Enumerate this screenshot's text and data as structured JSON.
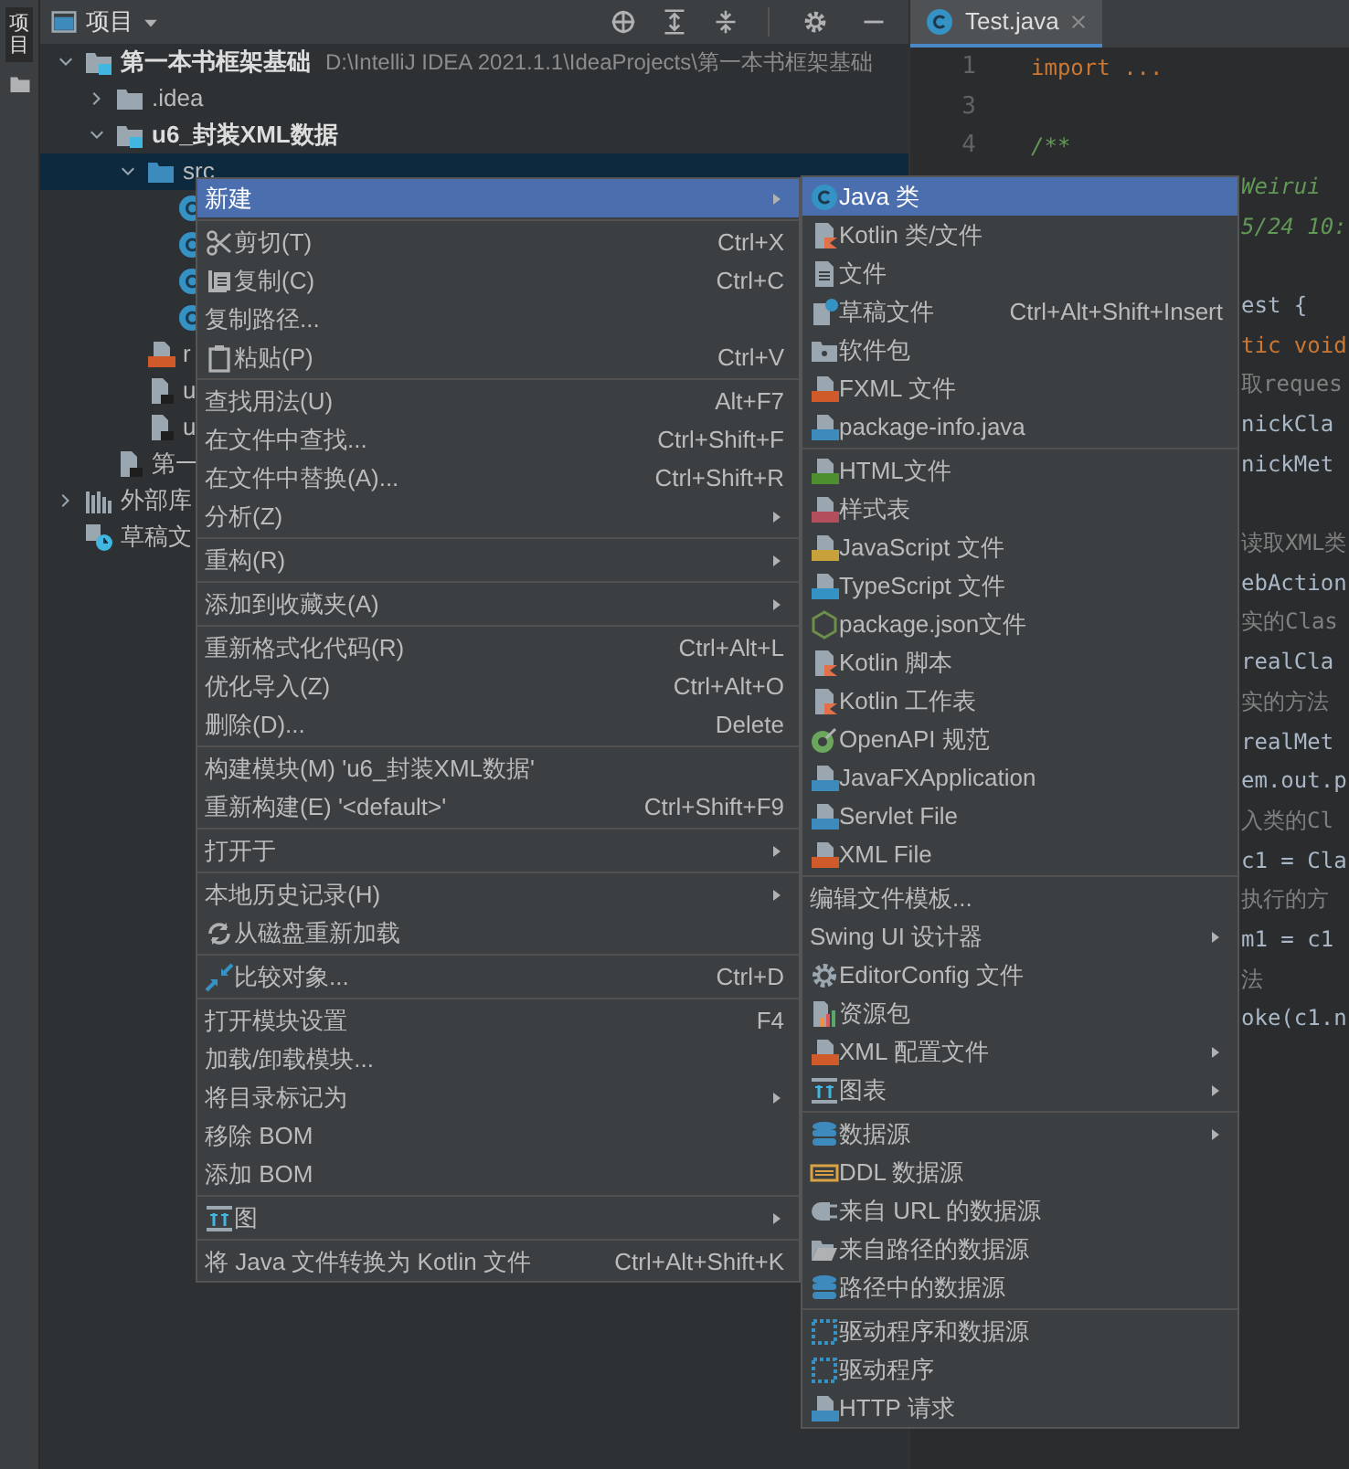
{
  "tool_strip": {
    "label": "项目"
  },
  "project_panel": {
    "title": "项目",
    "tree": [
      {
        "kind": "module",
        "label": "第一本书框架基础",
        "path": "D:\\IntelliJ IDEA 2021.1.1\\IdeaProjects\\第一本书框架基础",
        "expanded": true,
        "selected": false,
        "children": [
          {
            "kind": "folder",
            "label": ".idea",
            "expanded": false,
            "selected": false
          },
          {
            "kind": "module",
            "label": "u6_封装XML数据",
            "expanded": true,
            "selected": false,
            "children": [
              {
                "kind": "source",
                "label": "src",
                "expanded": true,
                "selected": true,
                "children": [
                  {
                    "kind": "class",
                    "selected": false
                  },
                  {
                    "kind": "class",
                    "selected": false
                  },
                  {
                    "kind": "class",
                    "selected": false
                  },
                  {
                    "kind": "class",
                    "selected": false
                  }
                ]
              },
              {
                "kind": "xml",
                "label": "r",
                "selected": false
              },
              {
                "kind": "file",
                "label": "u",
                "selected": false
              },
              {
                "kind": "file",
                "label": "u",
                "selected": false
              }
            ]
          },
          {
            "kind": "file",
            "label": "第一",
            "selected": false
          }
        ]
      },
      {
        "kind": "library",
        "label": "外部库",
        "expanded": false,
        "selected": false
      },
      {
        "kind": "scratch",
        "label": "草稿文",
        "selected": false
      }
    ]
  },
  "editor": {
    "tab": {
      "label": "Test.java",
      "selected": true
    },
    "lines": [
      {
        "number": "1",
        "text": "import ...",
        "kind": "keyword"
      },
      {
        "number": "3"
      },
      {
        "number": "4",
        "text": "/**",
        "kind": "comment"
      },
      {
        "text": "Weirui",
        "kind": "comment"
      },
      {
        "text": "5/24 10:",
        "kind": "comment"
      },
      {
        "kind": "blank"
      },
      {
        "text": "est {",
        "kind": "code"
      },
      {
        "text": "tic void",
        "kind": "keyword"
      },
      {
        "text": "取reques",
        "kind": "note"
      },
      {
        "text": "nickCla",
        "kind": "code"
      },
      {
        "text": "nickMet",
        "kind": "code"
      },
      {
        "kind": "blank"
      },
      {
        "text": "读取XML类",
        "kind": "note"
      },
      {
        "text": "ebAction",
        "kind": "code"
      },
      {
        "text": "实的Clas",
        "kind": "note"
      },
      {
        "text": "realCla",
        "kind": "code"
      },
      {
        "text": "实的方法",
        "kind": "note"
      },
      {
        "text": "realMet",
        "kind": "code"
      },
      {
        "text": "em.out.p",
        "kind": "code"
      },
      {
        "text": "入类的Cl",
        "kind": "note"
      },
      {
        "text": "c1 = Cla",
        "kind": "code"
      },
      {
        "text": "执行的方",
        "kind": "note"
      },
      {
        "text": "m1 = c1",
        "kind": "code"
      },
      {
        "text": "法",
        "kind": "note"
      },
      {
        "text": "oke(c1.n",
        "kind": "code"
      }
    ]
  },
  "context_menu": [
    {
      "kind": "item",
      "label": "新建",
      "submenu": true,
      "selected": true
    },
    {
      "kind": "separator"
    },
    {
      "kind": "item",
      "label": "剪切(T)",
      "shortcut": "Ctrl+X",
      "submenu": false,
      "selected": false
    },
    {
      "kind": "item",
      "label": "复制(C)",
      "shortcut": "Ctrl+C",
      "submenu": false,
      "selected": false
    },
    {
      "kind": "item",
      "label": "复制路径...",
      "submenu": false,
      "selected": false
    },
    {
      "kind": "item",
      "label": "粘贴(P)",
      "shortcut": "Ctrl+V",
      "submenu": false,
      "selected": false
    },
    {
      "kind": "separator"
    },
    {
      "kind": "item",
      "label": "查找用法(U)",
      "shortcut": "Alt+F7",
      "submenu": false,
      "selected": false
    },
    {
      "kind": "item",
      "label": "在文件中查找...",
      "shortcut": "Ctrl+Shift+F",
      "submenu": false,
      "selected": false
    },
    {
      "kind": "item",
      "label": "在文件中替换(A)...",
      "shortcut": "Ctrl+Shift+R",
      "submenu": false,
      "selected": false
    },
    {
      "kind": "item",
      "label": "分析(Z)",
      "submenu": true,
      "selected": false
    },
    {
      "kind": "separator"
    },
    {
      "kind": "item",
      "label": "重构(R)",
      "submenu": true,
      "selected": false
    },
    {
      "kind": "separator"
    },
    {
      "kind": "item",
      "label": "添加到收藏夹(A)",
      "submenu": true,
      "selected": false
    },
    {
      "kind": "separator"
    },
    {
      "kind": "item",
      "label": "重新格式化代码(R)",
      "shortcut": "Ctrl+Alt+L",
      "submenu": false,
      "selected": false
    },
    {
      "kind": "item",
      "label": "优化导入(Z)",
      "shortcut": "Ctrl+Alt+O",
      "submenu": false,
      "selected": false
    },
    {
      "kind": "item",
      "label": "删除(D)...",
      "shortcut": "Delete",
      "submenu": false,
      "selected": false
    },
    {
      "kind": "separator"
    },
    {
      "kind": "item",
      "label": "构建模块(M) 'u6_封装XML数据'",
      "submenu": false,
      "selected": false
    },
    {
      "kind": "item",
      "label": "重新构建(E) '<default>'",
      "shortcut": "Ctrl+Shift+F9",
      "submenu": false,
      "selected": false
    },
    {
      "kind": "separator"
    },
    {
      "kind": "item",
      "label": "打开于",
      "submenu": true,
      "selected": false
    },
    {
      "kind": "separator"
    },
    {
      "kind": "item",
      "label": "本地历史记录(H)",
      "submenu": true,
      "selected": false
    },
    {
      "kind": "item",
      "label": "从磁盘重新加载",
      "submenu": false,
      "selected": false
    },
    {
      "kind": "separator"
    },
    {
      "kind": "item",
      "label": "比较对象...",
      "shortcut": "Ctrl+D",
      "submenu": false,
      "selected": false
    },
    {
      "kind": "separator"
    },
    {
      "kind": "item",
      "label": "打开模块设置",
      "shortcut": "F4",
      "submenu": false,
      "selected": false
    },
    {
      "kind": "item",
      "label": "加载/卸载模块...",
      "submenu": false,
      "selected": false
    },
    {
      "kind": "item",
      "label": "将目录标记为",
      "submenu": true,
      "selected": false
    },
    {
      "kind": "item",
      "label": "移除 BOM",
      "submenu": false,
      "selected": false
    },
    {
      "kind": "item",
      "label": "添加 BOM",
      "submenu": false,
      "selected": false
    },
    {
      "kind": "separator"
    },
    {
      "kind": "item",
      "label": "图",
      "submenu": true,
      "selected": false
    },
    {
      "kind": "separator"
    },
    {
      "kind": "item",
      "label": "将 Java 文件转换为 Kotlin 文件",
      "shortcut": "Ctrl+Alt+Shift+K",
      "submenu": false,
      "selected": false
    }
  ],
  "new_submenu": [
    {
      "kind": "item",
      "label": "Java 类",
      "submenu": false,
      "selected": true
    },
    {
      "kind": "item",
      "label": "Kotlin 类/文件",
      "submenu": false,
      "selected": false
    },
    {
      "kind": "item",
      "label": "文件",
      "submenu": false,
      "selected": false
    },
    {
      "kind": "item",
      "label": "草稿文件",
      "shortcut": "Ctrl+Alt+Shift+Insert",
      "submenu": false,
      "selected": false
    },
    {
      "kind": "item",
      "label": "软件包",
      "submenu": false,
      "selected": false
    },
    {
      "kind": "item",
      "label": "FXML 文件",
      "submenu": false,
      "selected": false
    },
    {
      "kind": "item",
      "label": "package-info.java",
      "submenu": false,
      "selected": false
    },
    {
      "kind": "separator"
    },
    {
      "kind": "item",
      "label": "HTML文件",
      "submenu": false,
      "selected": false
    },
    {
      "kind": "item",
      "label": "样式表",
      "submenu": false,
      "selected": false
    },
    {
      "kind": "item",
      "label": "JavaScript 文件",
      "submenu": false,
      "selected": false
    },
    {
      "kind": "item",
      "label": "TypeScript 文件",
      "submenu": false,
      "selected": false
    },
    {
      "kind": "item",
      "label": "package.json文件",
      "submenu": false,
      "selected": false
    },
    {
      "kind": "item",
      "label": "Kotlin 脚本",
      "submenu": false,
      "selected": false
    },
    {
      "kind": "item",
      "label": "Kotlin 工作表",
      "submenu": false,
      "selected": false
    },
    {
      "kind": "item",
      "label": "OpenAPI 规范",
      "submenu": false,
      "selected": false
    },
    {
      "kind": "item",
      "label": "JavaFXApplication",
      "submenu": false,
      "selected": false
    },
    {
      "kind": "item",
      "label": "Servlet File",
      "submenu": false,
      "selected": false
    },
    {
      "kind": "item",
      "label": "XML File",
      "submenu": false,
      "selected": false
    },
    {
      "kind": "separator"
    },
    {
      "kind": "item",
      "label": "编辑文件模板...",
      "submenu": false,
      "selected": false
    },
    {
      "kind": "item",
      "label": "Swing UI 设计器",
      "submenu": true,
      "selected": false
    },
    {
      "kind": "item",
      "label": "EditorConfig 文件",
      "submenu": false,
      "selected": false
    },
    {
      "kind": "item",
      "label": "资源包",
      "submenu": false,
      "selected": false
    },
    {
      "kind": "item",
      "label": "XML 配置文件",
      "submenu": true,
      "selected": false
    },
    {
      "kind": "item",
      "label": "图表",
      "submenu": true,
      "selected": false
    },
    {
      "kind": "separator"
    },
    {
      "kind": "item",
      "label": "数据源",
      "submenu": true,
      "selected": false
    },
    {
      "kind": "item",
      "label": "DDL 数据源",
      "submenu": false,
      "selected": false
    },
    {
      "kind": "item",
      "label": "来自 URL 的数据源",
      "submenu": false,
      "selected": false
    },
    {
      "kind": "item",
      "label": "来自路径的数据源",
      "submenu": false,
      "selected": false
    },
    {
      "kind": "item",
      "label": "路径中的数据源",
      "submenu": false,
      "selected": false
    },
    {
      "kind": "separator"
    },
    {
      "kind": "item",
      "label": "驱动程序和数据源",
      "submenu": false,
      "selected": false
    },
    {
      "kind": "item",
      "label": "驱动程序",
      "submenu": false,
      "selected": false
    },
    {
      "kind": "item",
      "label": "HTTP 请求",
      "submenu": false,
      "selected": false
    }
  ]
}
